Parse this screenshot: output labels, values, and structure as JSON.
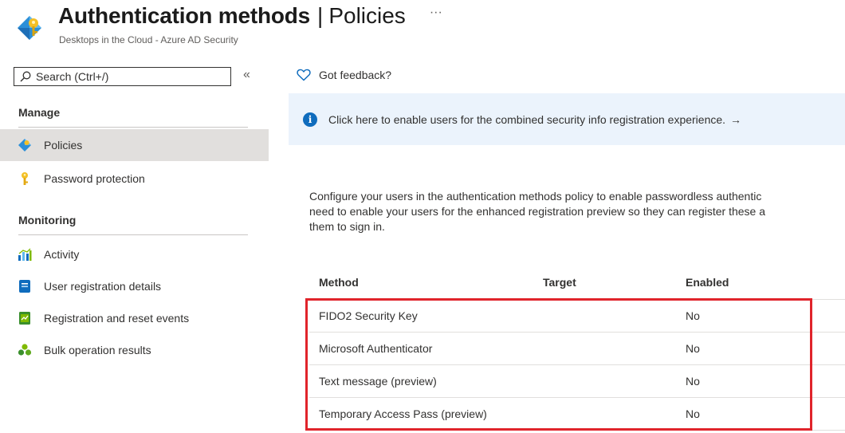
{
  "header": {
    "title": "Authentication methods",
    "separator": "|",
    "page": "Policies",
    "more": "···",
    "subtitle": "Desktops in the Cloud - Azure AD Security"
  },
  "sidebar": {
    "search_placeholder": "Search (Ctrl+/)",
    "collapse": "«",
    "sections": [
      {
        "label": "Manage",
        "items": [
          {
            "label": "Policies",
            "icon": "authentication-methods-icon",
            "active": true
          },
          {
            "label": "Password protection",
            "icon": "key-icon",
            "active": false
          }
        ]
      },
      {
        "label": "Monitoring",
        "items": [
          {
            "label": "Activity",
            "icon": "activity-chart-icon",
            "active": false
          },
          {
            "label": "User registration details",
            "icon": "registration-details-icon",
            "active": false
          },
          {
            "label": "Registration and reset events",
            "icon": "events-log-icon",
            "active": false
          },
          {
            "label": "Bulk operation results",
            "icon": "bulk-users-icon",
            "active": false
          }
        ]
      }
    ]
  },
  "main": {
    "feedback": "Got feedback?",
    "banner": "Click here to enable users for the combined security info registration experience.",
    "banner_arrow": "→",
    "description_lines": [
      "Configure your users in the authentication methods policy to enable passwordless authentic",
      "need to enable your users for the enhanced registration preview so they can register these a",
      "them to sign in."
    ],
    "table": {
      "headers": {
        "method": "Method",
        "target": "Target",
        "enabled": "Enabled"
      },
      "rows": [
        {
          "method": "FIDO2 Security Key",
          "target": "",
          "enabled": "No"
        },
        {
          "method": "Microsoft Authenticator",
          "target": "",
          "enabled": "No"
        },
        {
          "method": "Text message (preview)",
          "target": "",
          "enabled": "No"
        },
        {
          "method": "Temporary Access Pass (preview)",
          "target": "",
          "enabled": "No"
        }
      ]
    }
  },
  "colors": {
    "accent": "#0f6cbd",
    "banner_bg": "#ebf3fc",
    "selected_nav": "#e1dfdd",
    "highlight": "#e0242b"
  }
}
